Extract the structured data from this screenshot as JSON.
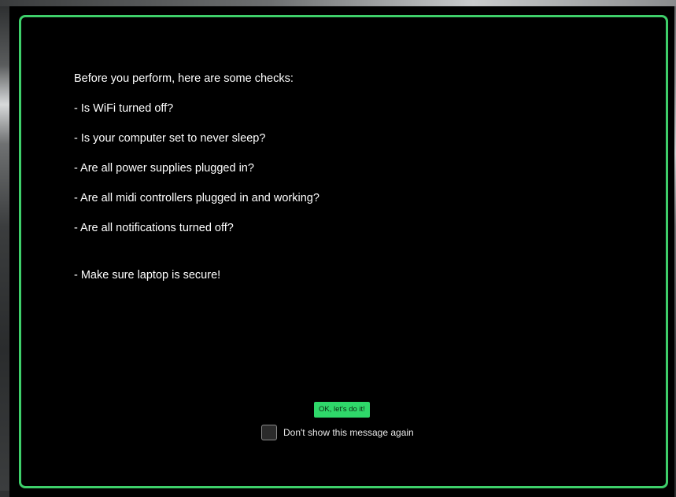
{
  "dialog": {
    "lines": [
      "Before you perform, here are some checks:",
      " - Is WiFi turned off?",
      " - Is your computer set to never sleep?",
      " - Are all power supplies plugged in?",
      " - Are all midi controllers plugged in and working?",
      " - Are all notifications turned off?",
      "- Make sure laptop is secure!"
    ],
    "ok_button_label": "OK, let's do it!",
    "dont_show_label": "Don't show this message again",
    "dont_show_checked": false
  },
  "colors": {
    "accent": "#3ecf6a",
    "button": "#2fd86a",
    "background": "#000000",
    "text": "#ffffff"
  }
}
